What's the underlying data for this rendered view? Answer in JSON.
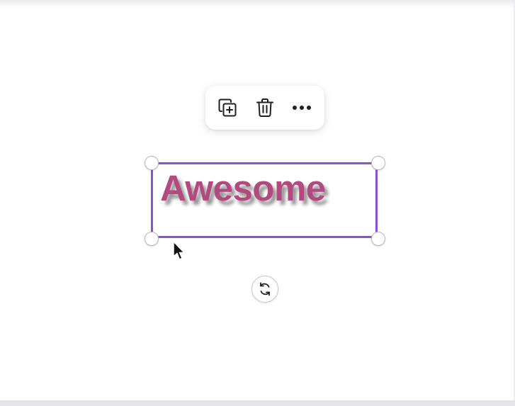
{
  "toolbar": {
    "buttons": [
      {
        "name": "duplicate",
        "icon": "duplicate-icon"
      },
      {
        "name": "delete",
        "icon": "trash-icon"
      },
      {
        "name": "more",
        "icon": "more-horizontal-icon"
      }
    ]
  },
  "text_element": {
    "text": "Awesome",
    "color": "#b24a7f",
    "effect": "drop-shadow"
  },
  "selection": {
    "border_color": "#8b4fd8"
  },
  "rotate": {
    "icon": "rotate-icon"
  },
  "cursor": {
    "icon": "mouse-pointer-icon"
  }
}
